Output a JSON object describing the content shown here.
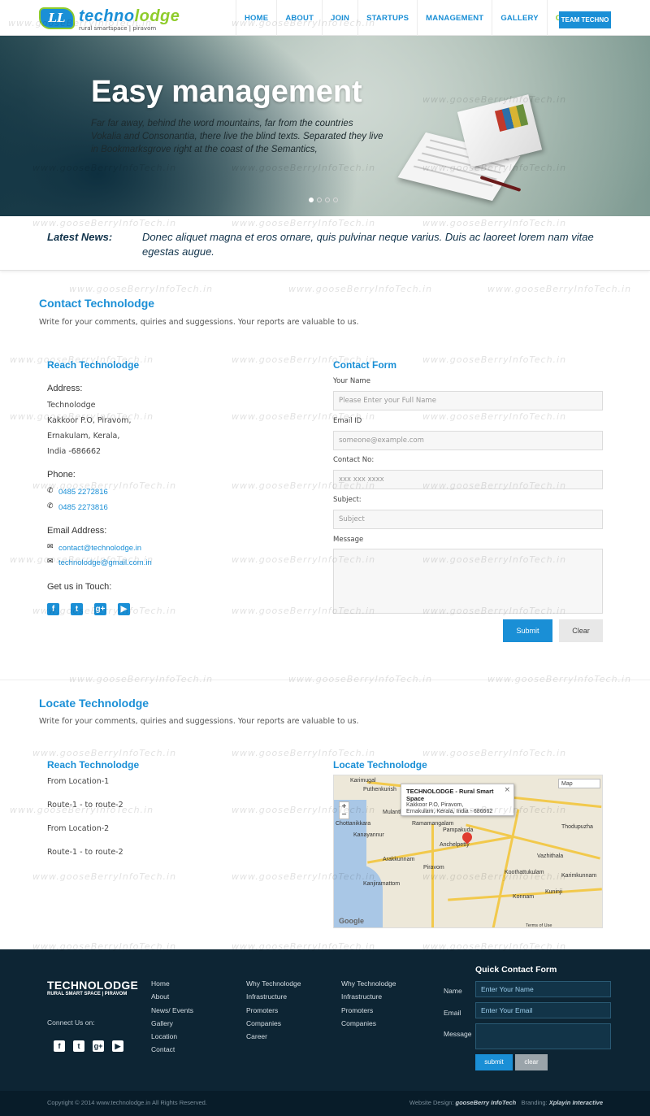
{
  "watermark": "www.gooseBerryInfoTech.in",
  "brand": {
    "logo_mark": "LL",
    "logo_first": "techno",
    "logo_rest": "lodge",
    "tagline": "rural smartspace | piravom"
  },
  "nav": {
    "items": [
      "HOME",
      "ABOUT",
      "JOIN",
      "STARTUPS",
      "MANAGEMENT",
      "GALLERY",
      "CONTACT"
    ],
    "active": "CONTACT",
    "team_button": "TEAM TECHNO"
  },
  "hero": {
    "title": "Easy management",
    "text": "Far far away, behind the word mountains, far from the countries Vokalia and Consonantia, there live the blind texts. Separated they live in Bookmarksgrove right at the coast of the Semantics,",
    "slide_count": 4,
    "active_slide": 1
  },
  "news": {
    "label": "Latest News:",
    "text": "Donec aliquet magna et eros ornare, quis pulvinar neque varius. Duis ac laoreet lorem nam vitae egestas augue."
  },
  "contact": {
    "title": "Contact Technolodge",
    "subtitle": "Write for your comments, quiries and suggessions. Your reports are valuable to us.",
    "reach": {
      "title": "Reach Technolodge",
      "address_label": "Address:",
      "address_lines": [
        "Technolodge",
        "Kakkoor P.O, Piravom,",
        "Ernakulam, Kerala,",
        "India -686662"
      ],
      "phone_label": "Phone:",
      "phones": [
        "0485 2272816",
        "0485 2273816"
      ],
      "email_label": "Email Address:",
      "emails": [
        "contact@technolodge.in",
        "technolodge@gmail.com.in"
      ],
      "touch_label": "Get us in Touch:",
      "social_icons": [
        "facebook-icon",
        "twitter-icon",
        "google-plus-icon",
        "youtube-icon"
      ]
    },
    "form": {
      "title": "Contact Form",
      "name_label": "Your Name",
      "name_placeholder": "Please Enter your Full Name",
      "email_label": "Email ID",
      "email_placeholder": "someone@example.com",
      "phone_label": "Contact No:",
      "phone_placeholder": "xxx xxx xxxx",
      "subject_label": "Subject:",
      "subject_placeholder": "Subject",
      "message_label": "Message",
      "submit": "Submit",
      "clear": "Clear"
    }
  },
  "locate": {
    "title": "Locate Technolodge",
    "subtitle": "Write for your comments, quiries and suggessions. Your reports are valuable to us.",
    "reach_title": "Reach Technolodge",
    "routes": [
      "From Location-1",
      "Route-1 - to route-2",
      "From Location-2",
      "Route-1 - to route-2"
    ],
    "map_title": "Locate Technolodge",
    "map": {
      "popup_title": "TECHNOLODGE - Rural Smart Space",
      "popup_addr1": "Kakkoor P.O, Piravom,",
      "popup_addr2": "Ernakulam, Kerala, India - 686662",
      "map_button": "Map",
      "terms": "Terms of Use",
      "google": "Google",
      "places": [
        "Karimugal",
        "Puthenkurish",
        "Ramamangalam",
        "Pampakuda",
        "Chottanikkara",
        "Kanayannur",
        "Arakkunnam",
        "Anchelpetty",
        "Piravom",
        "Kanjiramattom",
        "Koothattukulam",
        "Karimkunnam",
        "Vazhithala",
        "Mulanthuruthy",
        "Thodupuzha",
        "Konnam",
        "Kuninji"
      ]
    }
  },
  "footer": {
    "logo": "TECHNOLODGE",
    "logo_tag": "RURAL SMART SPACE  |  PIRAVOM",
    "connect": "Connect Us on:",
    "col1": [
      "Home",
      "About",
      "News/ Events",
      "Gallery",
      "Location",
      "Contact"
    ],
    "col2": [
      "Why Technolodge",
      "Infrastructure",
      "Promoters",
      "Companies",
      "Career"
    ],
    "col3": [
      "Why Technolodge",
      "Infrastructure",
      "Promoters",
      "Companies"
    ],
    "quick": {
      "title": "Quick Contact Form",
      "name_label": "Name",
      "name_placeholder": "Enter Your Name",
      "email_label": "Email",
      "email_placeholder": "Enter Your Email",
      "message_label": "Message",
      "submit": "submit",
      "clear": "clear"
    },
    "copyright": "Copyright  © 2014  www.technolodge.in  All Rights Reserved.",
    "design_label": "Website Design:",
    "design_by": "gooseBerry InfoTech",
    "branding_label": "Branding:",
    "branding_by": "Xplayin Interactive"
  },
  "colors": {
    "accent": "#1a8fd6",
    "green": "#8fcc2c",
    "footer_bg": "#0d2534"
  }
}
